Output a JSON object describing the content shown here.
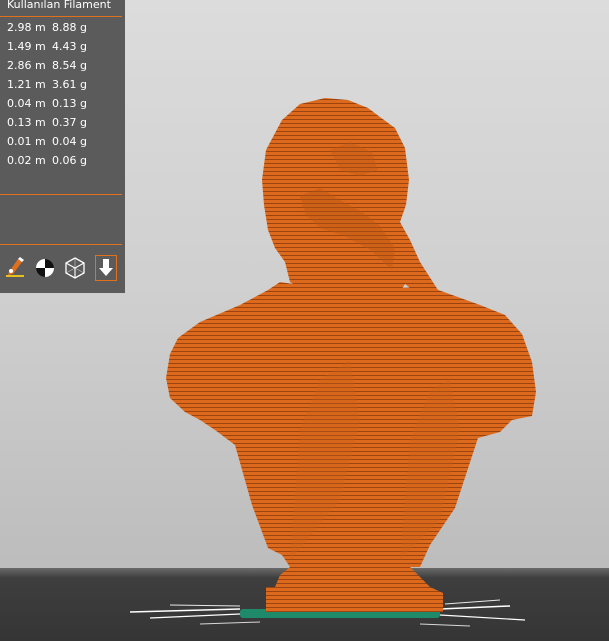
{
  "filament_panel": {
    "title": "Kullanılan Filament",
    "rows": [
      {
        "length": "2.98 m",
        "weight": "8.88 g"
      },
      {
        "length": "1.49 m",
        "weight": "4.43 g"
      },
      {
        "length": "2.86 m",
        "weight": "8.54 g"
      },
      {
        "length": "1.21 m",
        "weight": "3.61 g"
      },
      {
        "length": "0.04 m",
        "weight": "0.13 g"
      },
      {
        "length": "0.13 m",
        "weight": "0.37 g"
      },
      {
        "length": "0.01 m",
        "weight": "0.04 g"
      },
      {
        "length": "0.02 m",
        "weight": "0.06 g"
      }
    ]
  },
  "view_toolbar": {
    "icons": [
      "nozzle-edit-icon",
      "color-print-icon",
      "cube-view-icon",
      "layer-export-icon"
    ],
    "active_icon": "layer-export-icon"
  },
  "colors": {
    "panel_bg": "#5b5b5b",
    "accent": "#e0701e",
    "model_orange": "#dd6a1c",
    "floor": "#3a3a3a",
    "background": "#d0d0d0"
  }
}
